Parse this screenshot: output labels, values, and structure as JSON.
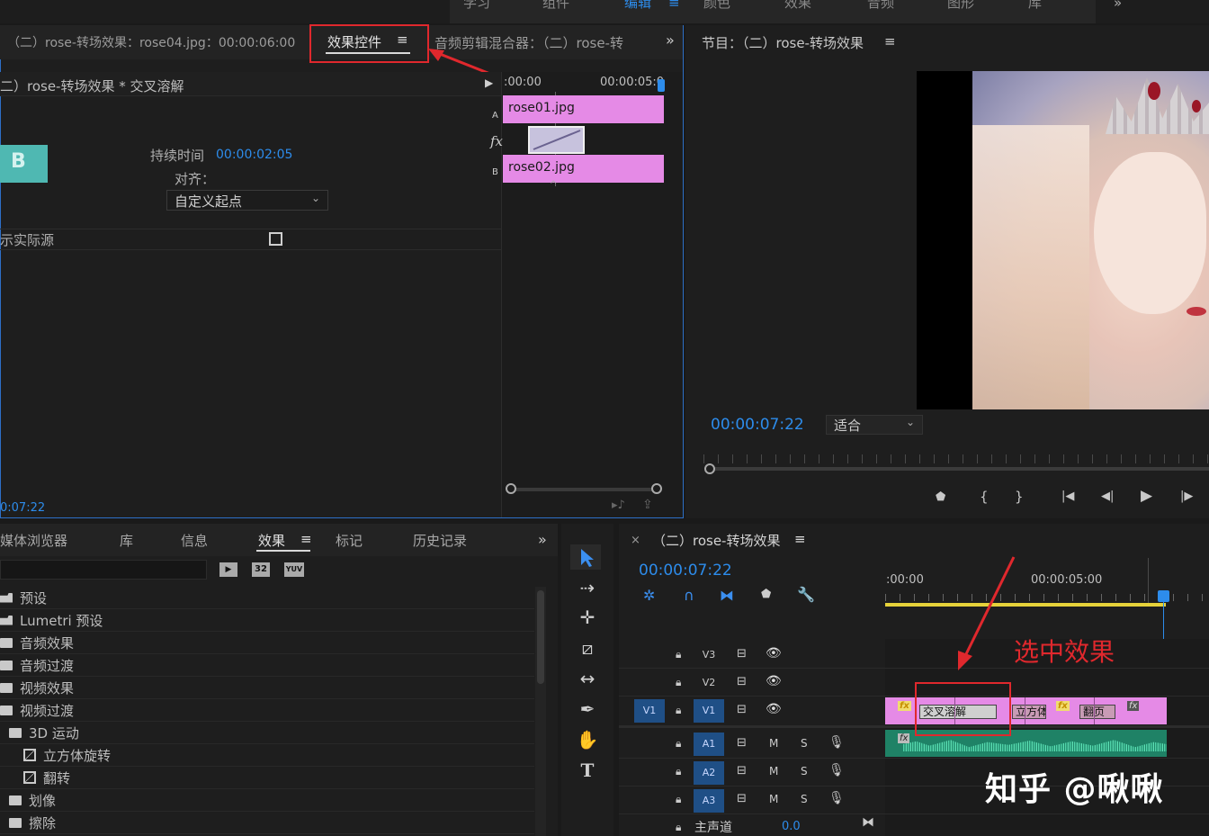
{
  "workspace_tabs": [
    "学习",
    "组件",
    "编辑",
    "颜色",
    "效果",
    "音频",
    "图形",
    "库"
  ],
  "source_panel": {
    "tab_sequence_clip": "（二）rose-转场效果：rose04.jpg：00:00:06:00",
    "tab_effect_controls": "效果控件",
    "tab_audio_mixer": "音频剪辑混合器：（二）rose-转",
    "clip_path": "二）rose-转场效果 * 交叉溶解",
    "duration_label": "持续时间",
    "duration_value": "00:00:02:05",
    "align_label": "对齐：",
    "align_value": "自定义起点",
    "show_actual_source": "示实际源",
    "timecode_bottom": "0:07:22",
    "mini_timeline": {
      "time_start": ":00:00",
      "time_end": "00:00:05:0",
      "track_a": "A",
      "track_b": "B",
      "clip_a": "rose01.jpg",
      "clip_b": "rose02.jpg",
      "fx_label": "fx"
    }
  },
  "program_panel": {
    "title": "节目：（二）rose-转场效果",
    "timecode": "00:00:07:22",
    "zoom_value": "适合"
  },
  "effects_panel": {
    "tabs": [
      "媒体浏览器",
      "库",
      "信息",
      "效果",
      "标记",
      "历史记录"
    ],
    "active_tab": "效果",
    "icons": [
      "32",
      "YUV"
    ],
    "items": [
      {
        "label": "预设",
        "indent": 0,
        "icon": "star-folder-icon"
      },
      {
        "label": "Lumetri 预设",
        "indent": 0,
        "icon": "star-folder-icon"
      },
      {
        "label": "音频效果",
        "indent": 0,
        "icon": "folder-icon"
      },
      {
        "label": "音频过渡",
        "indent": 0,
        "icon": "folder-icon"
      },
      {
        "label": "视频效果",
        "indent": 0,
        "icon": "folder-icon"
      },
      {
        "label": "视频过渡",
        "indent": 0,
        "icon": "folder-icon"
      },
      {
        "label": "3D 运动",
        "indent": 1,
        "icon": "folder-icon"
      },
      {
        "label": "立方体旋转",
        "indent": 2,
        "icon": "transition-icon"
      },
      {
        "label": "翻转",
        "indent": 2,
        "icon": "transition-icon"
      },
      {
        "label": "划像",
        "indent": 1,
        "icon": "folder-icon"
      },
      {
        "label": "擦除",
        "indent": 1,
        "icon": "folder-icon"
      }
    ]
  },
  "timeline_panel": {
    "close": "×",
    "title": "（二）rose-转场效果",
    "timecode": "00:00:07:22",
    "ruler_start": ":00:00",
    "ruler_mid": "00:00:05:00",
    "tracks_video": [
      "V3",
      "V2",
      "V1"
    ],
    "source_patch": "V1",
    "tracks_audio": [
      "A1",
      "A2",
      "A3"
    ],
    "mute": "M",
    "solo": "S",
    "master_label": "主声道",
    "master_value": "0.0",
    "clips": [
      "交叉溶解",
      "立方体",
      "翻页"
    ],
    "fx": "fx"
  },
  "annotations": {
    "select_effect": "选中效果",
    "watermark": "知乎 @啾啾"
  },
  "colors": {
    "accent_blue": "#2d8ceb",
    "clip_pink": "#e58ae6",
    "audio_green": "#3cc79a",
    "annotation_red": "#e0282d"
  }
}
